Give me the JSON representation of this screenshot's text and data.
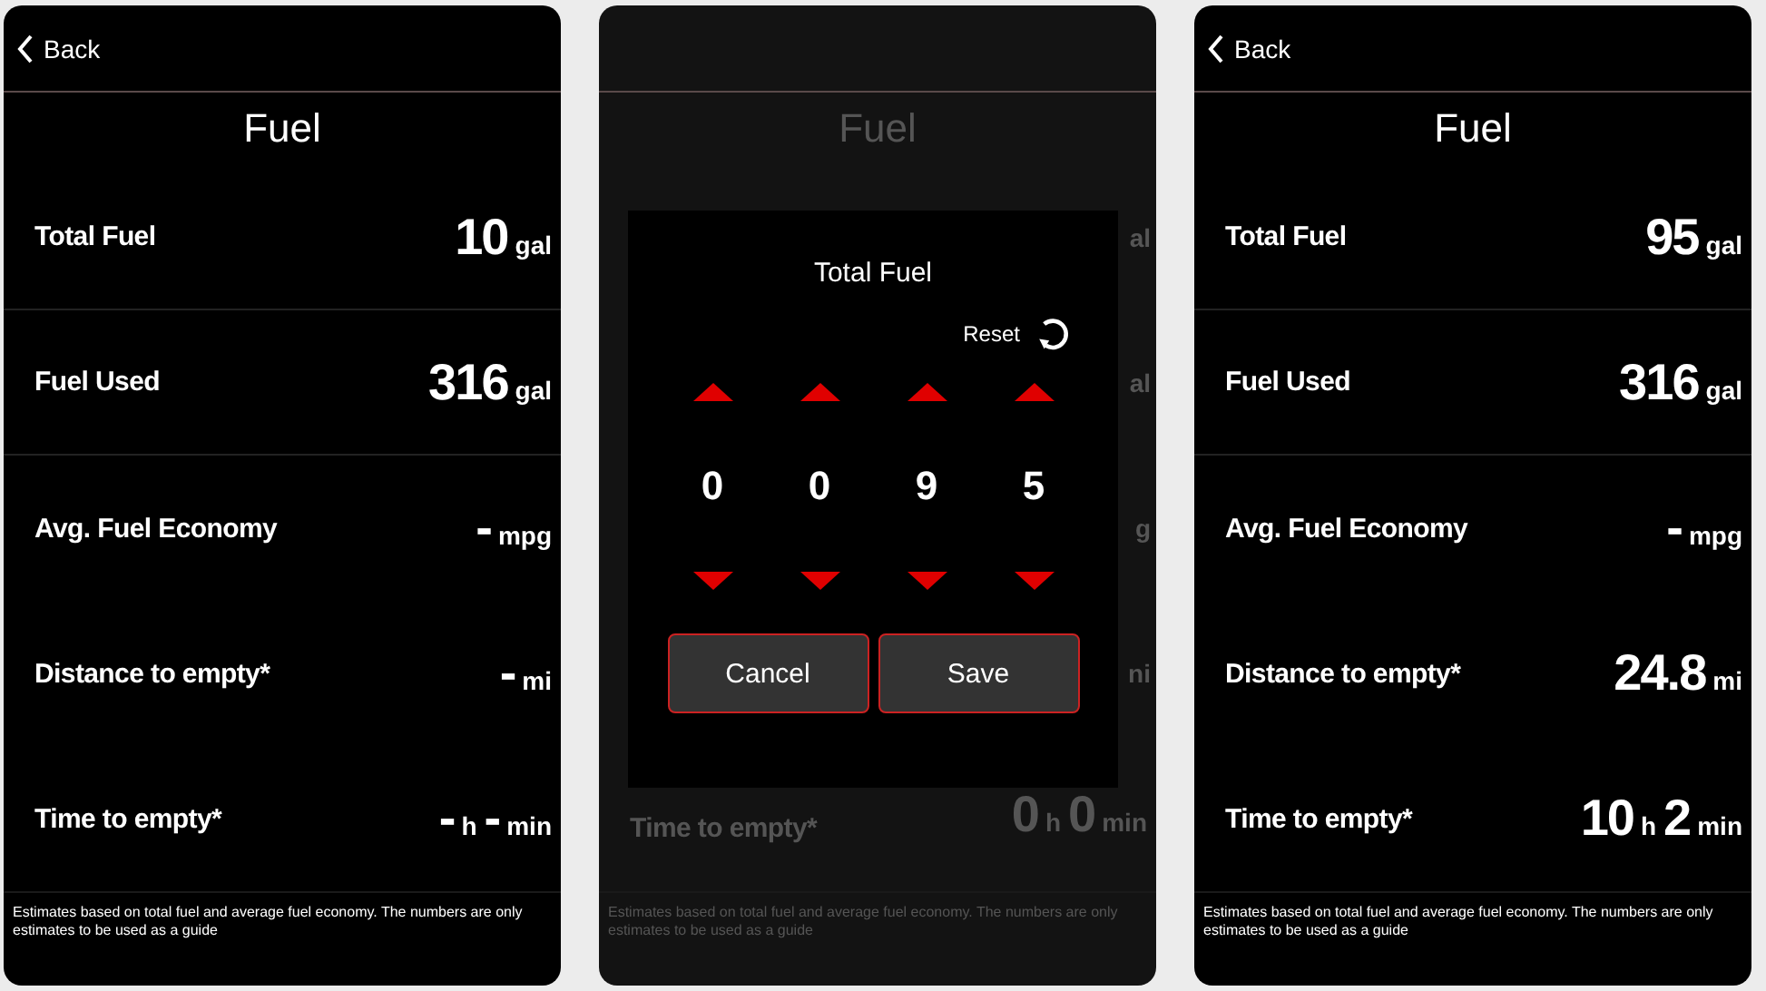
{
  "screens": [
    {
      "kind": "detail",
      "back": "Back",
      "title": "Fuel",
      "rows": [
        {
          "label": "Total Fuel",
          "parts": [
            {
              "value": "10",
              "unit": "gal"
            }
          ]
        },
        {
          "label": "Fuel Used",
          "parts": [
            {
              "value": "316",
              "unit": "gal"
            }
          ]
        },
        {
          "label": "Avg. Fuel Economy",
          "parts": [
            {
              "value": "-",
              "unit": "mpg"
            }
          ]
        },
        {
          "label": "Distance to empty*",
          "parts": [
            {
              "value": "-",
              "unit": "mi"
            }
          ]
        },
        {
          "label": "Time to empty*",
          "parts": [
            {
              "value": "-",
              "unit": "h"
            },
            {
              "value": "-",
              "unit": "min"
            }
          ]
        }
      ],
      "footnote": "Estimates based on total fuel and average fuel economy. The numbers are only estimates to be used as a guide"
    },
    {
      "kind": "dialog",
      "title": "Fuel",
      "fragments": [
        "al",
        "al",
        "g",
        "ni"
      ],
      "last_row": {
        "label": "Time to empty*",
        "parts": [
          {
            "value": "0",
            "unit": "h"
          },
          {
            "value": "0",
            "unit": "min"
          }
        ]
      },
      "footnote": "Estimates based on total fuel and average fuel economy. The numbers are only estimates to be used as a guide",
      "dialog": {
        "title": "Total Fuel",
        "reset": "Reset",
        "digits": [
          "0",
          "0",
          "9",
          "5"
        ],
        "buttons": [
          "Cancel",
          "Save"
        ]
      }
    },
    {
      "kind": "detail",
      "back": "Back",
      "title": "Fuel",
      "rows": [
        {
          "label": "Total Fuel",
          "parts": [
            {
              "value": "95",
              "unit": "gal"
            }
          ]
        },
        {
          "label": "Fuel Used",
          "parts": [
            {
              "value": "316",
              "unit": "gal"
            }
          ]
        },
        {
          "label": "Avg. Fuel Economy",
          "parts": [
            {
              "value": "-",
              "unit": "mpg"
            }
          ]
        },
        {
          "label": "Distance to empty*",
          "parts": [
            {
              "value": "24.8",
              "unit": "mi"
            }
          ]
        },
        {
          "label": "Time to empty*",
          "parts": [
            {
              "value": "10",
              "unit": "h"
            },
            {
              "value": "2",
              "unit": "min"
            }
          ]
        }
      ],
      "footnote": "Estimates based on total fuel and average fuel economy. The numbers are only estimates to be used as a guide"
    }
  ]
}
